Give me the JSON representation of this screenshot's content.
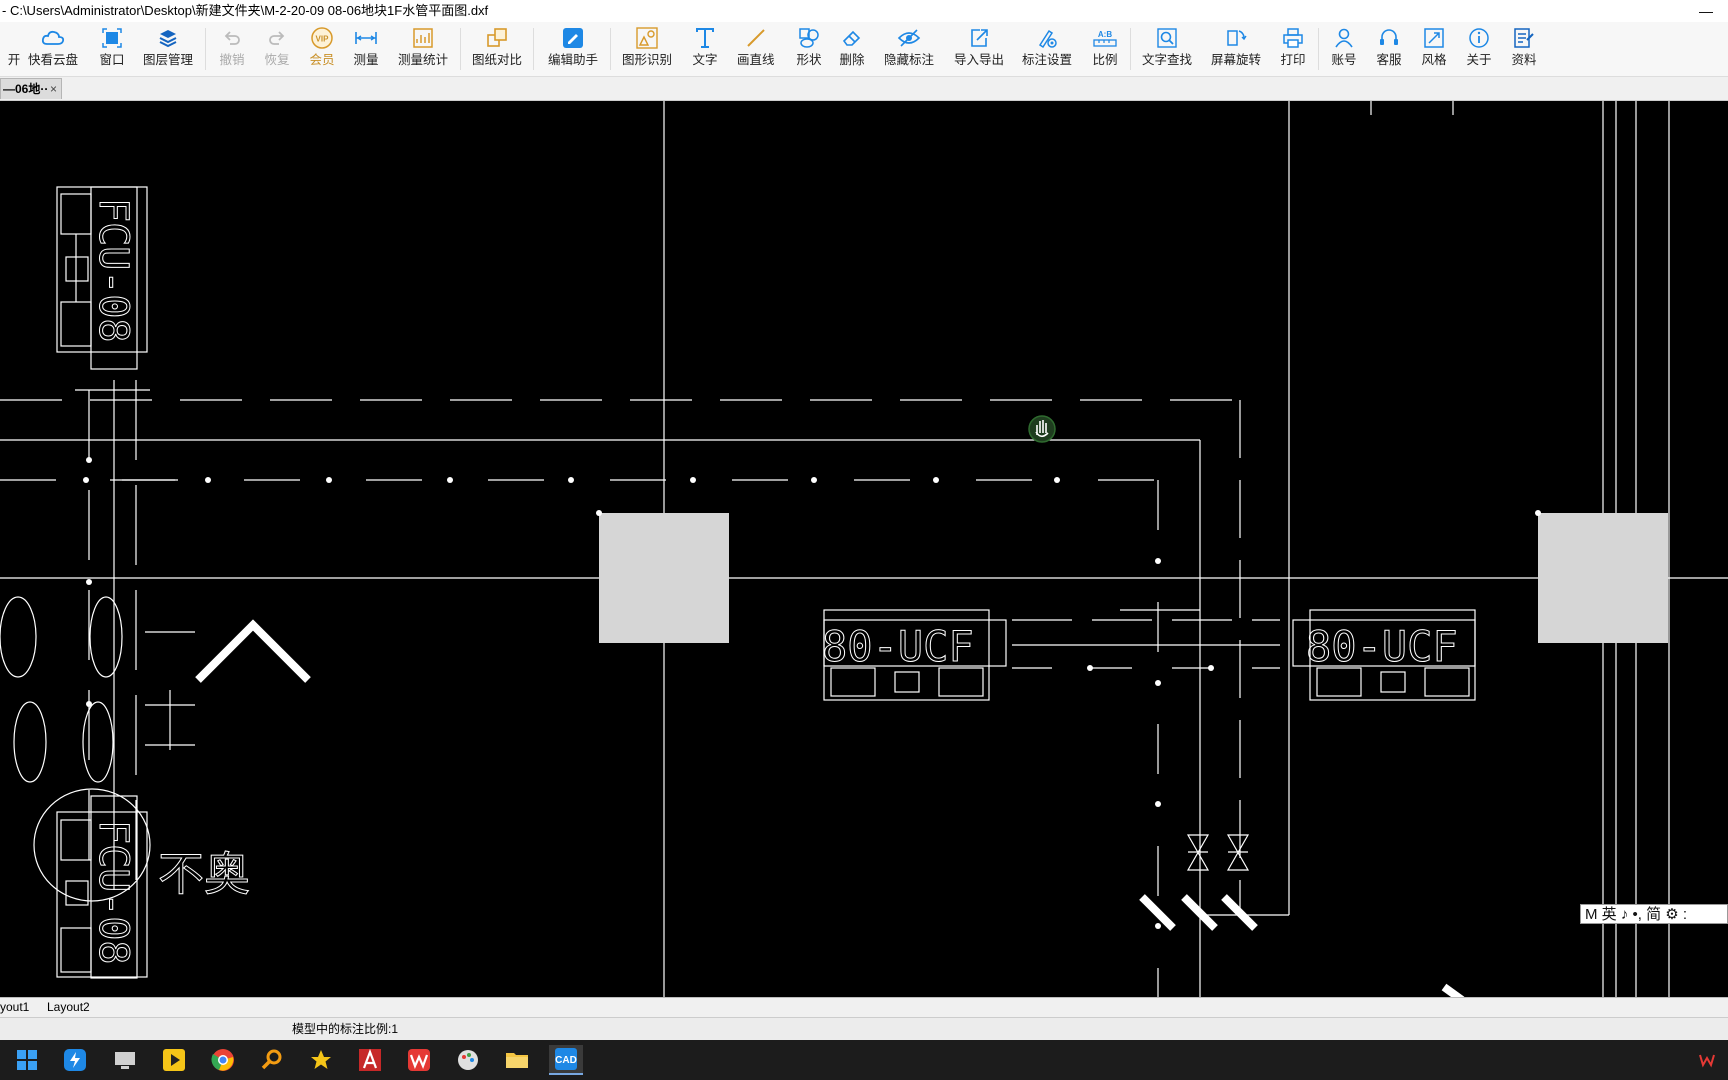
{
  "window": {
    "title": "- C:\\Users\\Administrator\\Desktop\\新建文件夹\\M-2-20-09  08-06地块1F水管平面图.dxf",
    "minimize": "—"
  },
  "toolbar": {
    "open_partial": "开",
    "items": [
      {
        "label": "快看云盘",
        "icon": "cloud-icon"
      },
      {
        "label": "窗口",
        "icon": "window-icon"
      },
      {
        "label": "图层管理",
        "icon": "layers-icon"
      },
      {
        "label": "撤销",
        "icon": "undo-icon"
      },
      {
        "label": "恢复",
        "icon": "redo-icon"
      },
      {
        "label": "会员",
        "icon": "vip-icon"
      },
      {
        "label": "测量",
        "icon": "ruler-icon"
      },
      {
        "label": "测量统计",
        "icon": "measure-stats-icon"
      },
      {
        "label": "图纸对比",
        "icon": "compare-icon"
      },
      {
        "label": "编辑助手",
        "icon": "edit-assistant-icon"
      },
      {
        "label": "图形识别",
        "icon": "shape-recognition-icon"
      },
      {
        "label": "文字",
        "icon": "text-icon"
      },
      {
        "label": "画直线",
        "icon": "line-icon"
      },
      {
        "label": "形状",
        "icon": "shapes-icon"
      },
      {
        "label": "删除",
        "icon": "eraser-icon"
      },
      {
        "label": "隐藏标注",
        "icon": "eye-hide-icon"
      },
      {
        "label": "导入导出",
        "icon": "import-export-icon"
      },
      {
        "label": "标注设置",
        "icon": "annotation-settings-icon"
      },
      {
        "label": "比例",
        "icon": "scale-icon"
      },
      {
        "label": "文字查找",
        "icon": "text-search-icon"
      },
      {
        "label": "屏幕旋转",
        "icon": "rotate-screen-icon"
      },
      {
        "label": "打印",
        "icon": "printer-icon"
      },
      {
        "label": "账号",
        "icon": "account-icon"
      },
      {
        "label": "客服",
        "icon": "headset-icon"
      },
      {
        "label": "风格",
        "icon": "style-icon"
      },
      {
        "label": "关于",
        "icon": "info-icon"
      },
      {
        "label": "资料",
        "icon": "documents-icon"
      }
    ]
  },
  "tabs": {
    "doc_tab": "—06地··",
    "close": "×"
  },
  "drawing": {
    "labels": {
      "fcu_vertical_top": "FCU-08",
      "fcu_horizontal_mid": "80-UCF",
      "fcu_horizontal_right": "80-UCF",
      "fcu_vertical_bottom": "FCU-08",
      "handwritten": "不奥"
    }
  },
  "layouts": {
    "tab1": "yout1",
    "tab2": "Layout2"
  },
  "status": {
    "text": "模型中的标注比例:1"
  },
  "ime": {
    "text": "M 英 ♪ •, 简 ⚙ :"
  },
  "taskbar": {
    "apps": [
      "windows-start-icon",
      "app-blue-icon",
      "desktop-icon",
      "player-icon",
      "chrome-icon",
      "search-icon",
      "star-icon",
      "autocad-icon",
      "wps-icon",
      "paint-icon",
      "folder-icon",
      "cad-viewer-icon"
    ],
    "tray": "wps-tray-icon"
  }
}
